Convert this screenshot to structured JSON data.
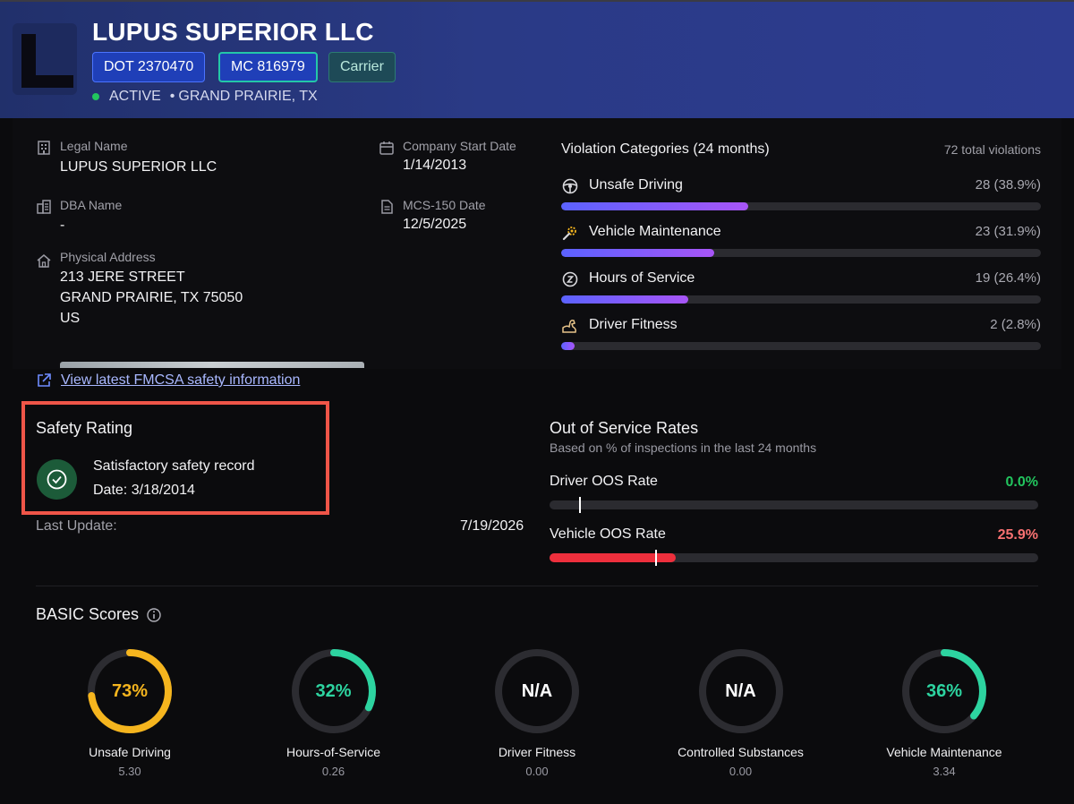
{
  "header": {
    "company_name": "LUPUS SUPERIOR LLC",
    "dot_badge": "DOT 2370470",
    "mc_badge": "MC 816979",
    "type_badge": "Carrier",
    "status": "ACTIVE",
    "location": "GRAND PRAIRIE, TX",
    "location_prefix": "•"
  },
  "details": {
    "legal_name_label": "Legal Name",
    "legal_name": "LUPUS SUPERIOR LLC",
    "dba_label": "DBA Name",
    "dba": "-",
    "address_label": "Physical Address",
    "address_line1": "213 JERE STREET",
    "address_line2": "GRAND PRAIRIE,  TX 75050",
    "address_line3": "US",
    "start_date_label": "Company Start Date",
    "start_date": "1/14/2013",
    "mcs150_label": "MCS-150 Date",
    "mcs150": "12/5/2025"
  },
  "violations": {
    "title": "Violation Categories (24 months)",
    "total": "72 total violations",
    "items": [
      {
        "name": "Unsafe Driving",
        "count": "28 (38.9%)",
        "pct": 38.9,
        "icon": "steering-wheel-icon"
      },
      {
        "name": "Vehicle Maintenance",
        "count": "23 (31.9%)",
        "pct": 31.9,
        "icon": "wrench-gear-icon"
      },
      {
        "name": "Hours of Service",
        "count": "19 (26.4%)",
        "pct": 26.4,
        "icon": "sleep-clock-icon"
      },
      {
        "name": "Driver Fitness",
        "count": "2 (2.8%)",
        "pct": 2.8,
        "icon": "flexed-arm-icon"
      }
    ]
  },
  "link": {
    "text": "View latest FMCSA safety information"
  },
  "safety": {
    "title": "Safety Rating",
    "rating": "Satisfactory safety record",
    "date": "Date: 3/18/2014",
    "last_update_label": "Last Update:",
    "last_update": "7/19/2026"
  },
  "oos": {
    "title": "Out of Service Rates",
    "subtitle": "Based on % of inspections in the last 24 months",
    "driver_label": "Driver OOS Rate",
    "driver_value": "0.0%",
    "driver_pct": 0.0,
    "driver_benchmark_fraction": 0.06,
    "vehicle_label": "Vehicle OOS Rate",
    "vehicle_value": "25.9%",
    "vehicle_pct": 25.9,
    "vehicle_benchmark_fraction": 0.216,
    "colors": {
      "good": "#22c55e",
      "bad": "#f87171"
    }
  },
  "basic": {
    "title": "BASIC Scores",
    "scores": [
      {
        "name": "Unsafe Driving",
        "display": "73%",
        "percent": 73,
        "score": "5.30",
        "color": "#f5b51e"
      },
      {
        "name": "Hours-of-Service",
        "display": "32%",
        "percent": 32,
        "score": "0.26",
        "color": "#2dd4a0"
      },
      {
        "name": "Driver Fitness",
        "display": "N/A",
        "percent": 0,
        "score": "0.00",
        "color": "#ffffff"
      },
      {
        "name": "Controlled Substances",
        "display": "N/A",
        "percent": 0,
        "score": "0.00",
        "color": "#ffffff"
      },
      {
        "name": "Vehicle Maintenance",
        "display": "36%",
        "percent": 36,
        "score": "3.34",
        "color": "#2dd4a0"
      }
    ]
  }
}
